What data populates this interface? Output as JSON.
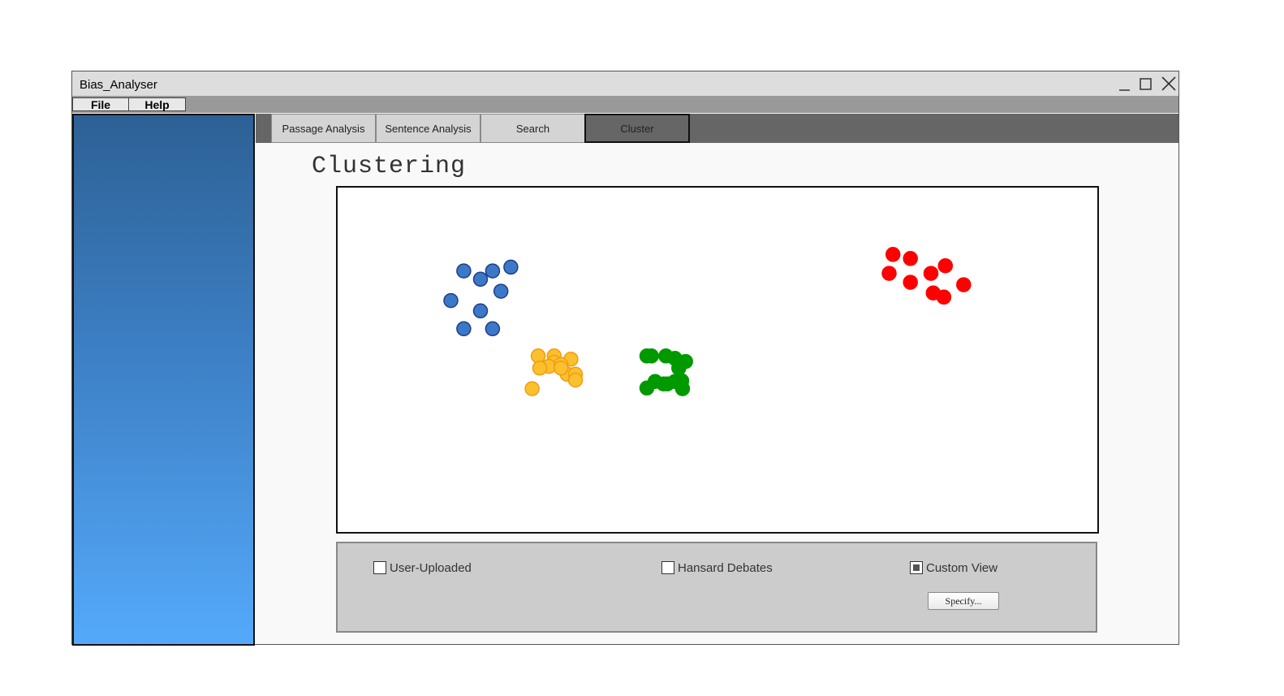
{
  "window": {
    "title": "Bias_Analyser"
  },
  "menu": {
    "items": [
      "File",
      "Help"
    ]
  },
  "tabs": [
    {
      "label": "Passage Analysis",
      "active": false
    },
    {
      "label": "Sentence Analysis",
      "active": false
    },
    {
      "label": "Search",
      "active": false
    },
    {
      "label": "Cluster",
      "active": true
    }
  ],
  "page": {
    "heading": "Clustering"
  },
  "chart_data": {
    "type": "scatter",
    "title": "",
    "xlabel": "",
    "ylabel": "",
    "axes_visible": false,
    "grid": false,
    "xlim": [
      0,
      100
    ],
    "ylim": [
      0,
      100
    ],
    "series": [
      {
        "color": "#3b78c8",
        "stroke": "#1f3f85",
        "x": [
          16.6,
          18.8,
          20.4,
          22.8,
          14.9,
          21.5,
          18.8,
          16.6,
          20.4
        ],
        "y": [
          75.8,
          73.4,
          75.8,
          76.9,
          67.2,
          69.9,
          64.2,
          59.0,
          59.0
        ]
      },
      {
        "color": "#fbc02d",
        "stroke": "#f39c12",
        "x": [
          26.4,
          28.5,
          30.7,
          28.5,
          27.8,
          29.4,
          30.2,
          31.3,
          31.3,
          26.6,
          29.4,
          25.6
        ],
        "y": [
          51.1,
          51.1,
          50.2,
          49.3,
          48.1,
          48.6,
          45.8,
          45.8,
          44.1,
          47.6,
          47.6,
          41.6
        ]
      },
      {
        "color": "#009900",
        "stroke": "#009900",
        "x": [
          40.7,
          41.3,
          43.2,
          44.9,
          45.8,
          44.4,
          41.8,
          42.9,
          43.4,
          44.4,
          45.3,
          40.7,
          45.4
        ],
        "y": [
          51.1,
          51.1,
          51.1,
          47.6,
          49.5,
          50.4,
          43.7,
          43.0,
          43.0,
          43.7,
          43.9,
          41.8,
          41.6
        ]
      },
      {
        "color": "#ff0000",
        "stroke": "#ff0000",
        "x": [
          73.1,
          75.4,
          72.6,
          75.4,
          78.1,
          80.0,
          78.4,
          79.8,
          82.4
        ],
        "y": [
          80.6,
          79.4,
          75.1,
          72.5,
          75.1,
          77.3,
          69.4,
          68.2,
          71.8
        ]
      }
    ]
  },
  "options": {
    "checkboxes": [
      {
        "label": "User-Uploaded",
        "checked": false
      },
      {
        "label": "Hansard Debates",
        "checked": false
      },
      {
        "label": "Custom View",
        "checked": true
      }
    ],
    "specify_label": "Specify..."
  },
  "icons": [
    "minimize-icon",
    "maximize-icon",
    "close-icon"
  ]
}
